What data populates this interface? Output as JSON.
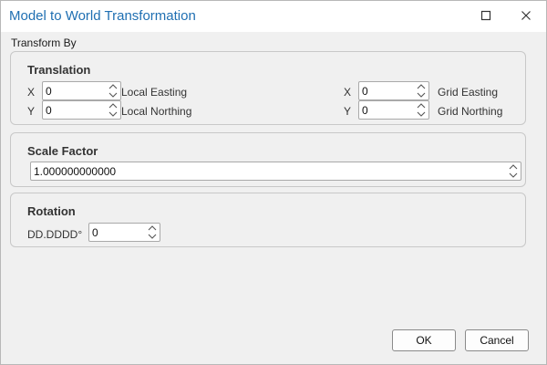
{
  "window": {
    "title": "Model to World Transformation",
    "maximize_icon": "maximize-icon",
    "close_icon": "close-icon"
  },
  "transform_by_label": "Transform By",
  "translation": {
    "title": "Translation",
    "local": {
      "x_axis": "X",
      "y_axis": "Y",
      "x_value": "0",
      "y_value": "0",
      "x_label": "Local Easting",
      "y_label": "Local Northing"
    },
    "grid": {
      "x_axis": "X",
      "y_axis": "Y",
      "x_value": "0",
      "y_value": "0",
      "x_label": "Grid Easting",
      "y_label": "Grid Northing"
    }
  },
  "scale_factor": {
    "title": "Scale Factor",
    "value": "1.000000000000"
  },
  "rotation": {
    "title": "Rotation",
    "unit_label": "DD.DDDD°",
    "value": "0"
  },
  "buttons": {
    "ok": "OK",
    "cancel": "Cancel"
  },
  "colors": {
    "title": "#1f6fb2",
    "background": "#f0f0f0"
  }
}
